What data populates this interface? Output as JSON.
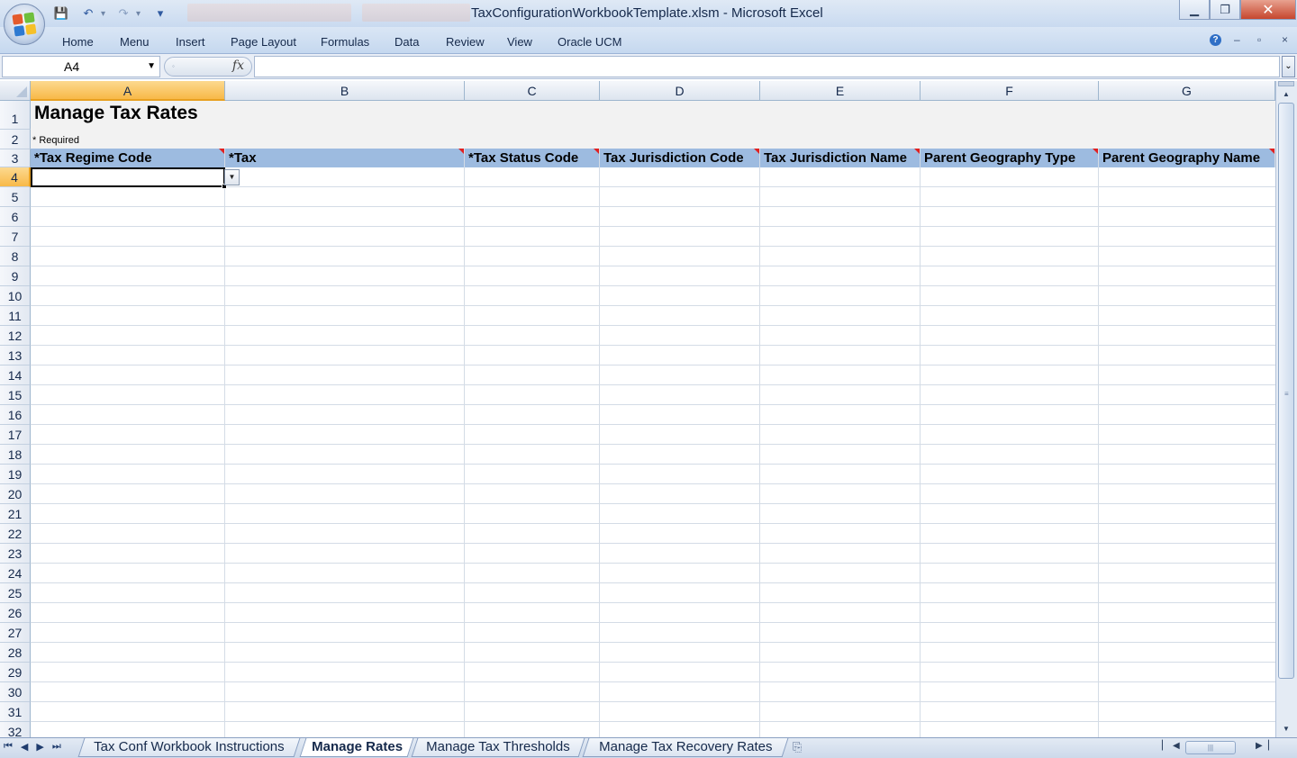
{
  "window": {
    "title": "TaxConfigurationWorkbookTemplate.xlsm - Microsoft Excel",
    "min_label": "▁",
    "max_label": "❐",
    "close_label": "✕"
  },
  "quick_access": {
    "save": "💾",
    "undo": "↶",
    "redo": "↷",
    "customize": "▾"
  },
  "ribbon": {
    "tabs": [
      "Home",
      "Menu",
      "Insert",
      "Page Layout",
      "Formulas",
      "Data",
      "Review",
      "View",
      "Oracle UCM"
    ],
    "help": "?",
    "min": "–",
    "restore": "▫",
    "close": "×"
  },
  "formula_bar": {
    "name_box": "A4",
    "fx": "fx",
    "formula": ""
  },
  "columns": [
    "A",
    "B",
    "C",
    "D",
    "E",
    "F",
    "G"
  ],
  "rows": [
    "1",
    "2",
    "3",
    "4",
    "5",
    "6",
    "7",
    "8",
    "9",
    "10",
    "11",
    "12",
    "13",
    "14",
    "15",
    "16",
    "17",
    "18",
    "19",
    "20",
    "21",
    "22",
    "23",
    "24",
    "25",
    "26",
    "27",
    "28",
    "29",
    "30",
    "31",
    "32"
  ],
  "sheet": {
    "title": "Manage Tax Rates",
    "required_note": "* Required",
    "headers": [
      "*Tax Regime Code",
      "*Tax",
      "*Tax Status Code",
      "Tax Jurisdiction Code",
      "Tax Jurisdiction Name",
      "Parent Geography Type",
      "Parent Geography Name"
    ]
  },
  "sheet_tabs": [
    {
      "label": "Tax Conf Workbook Instructions",
      "active": false
    },
    {
      "label": "Manage Rates",
      "active": true
    },
    {
      "label": "Manage Tax Thresholds",
      "active": false
    },
    {
      "label": "Manage Tax Recovery Rates",
      "active": false
    }
  ],
  "icons": {
    "office_button": "office-logo-icon",
    "dropdown": "chevron-down-icon"
  }
}
